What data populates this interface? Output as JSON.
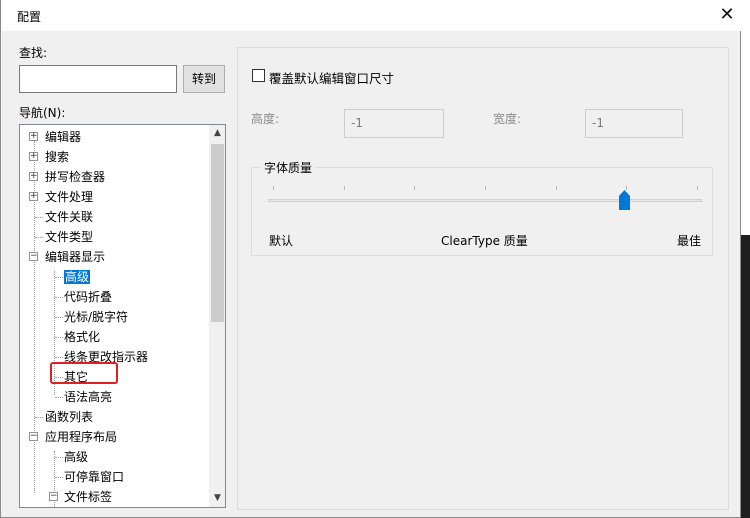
{
  "dialog": {
    "title": "配置",
    "close_glyph": "✕"
  },
  "search": {
    "label": "查找:",
    "value": "",
    "goto_label": "转到"
  },
  "nav": {
    "label": "导航(N):",
    "items": [
      {
        "label": "编辑器",
        "expander": "+"
      },
      {
        "label": "搜索",
        "expander": "+"
      },
      {
        "label": "拼写检查器",
        "expander": "+"
      },
      {
        "label": "文件处理",
        "expander": "+"
      },
      {
        "label": "文件关联"
      },
      {
        "label": "文件类型"
      },
      {
        "label": "编辑器显示",
        "expander": "−"
      },
      {
        "label": "高级"
      },
      {
        "label": "代码折叠"
      },
      {
        "label": "光标/脱字符"
      },
      {
        "label": "格式化"
      },
      {
        "label": "线条更改指示器"
      },
      {
        "label": "其它"
      },
      {
        "label": "语法高亮"
      },
      {
        "label": "函数列表"
      },
      {
        "label": "应用程序布局",
        "expander": "−"
      },
      {
        "label": "高级"
      },
      {
        "label": "可停靠窗口"
      },
      {
        "label": "文件标签",
        "expander": "−"
      }
    ],
    "selected_index": 7
  },
  "override": {
    "label": "覆盖默认编辑窗口尺寸",
    "checked": false
  },
  "height": {
    "label": "高度:",
    "value": "-1"
  },
  "width": {
    "label": "宽度:",
    "value": "-1"
  },
  "font_quality": {
    "title": "字体质量",
    "min_label": "默认",
    "mid_label": "ClearType 质量",
    "max_label": "最佳",
    "slider_level": 0.83
  },
  "colors": {
    "accent": "#0078d7",
    "highlight_box": "#e02020"
  }
}
